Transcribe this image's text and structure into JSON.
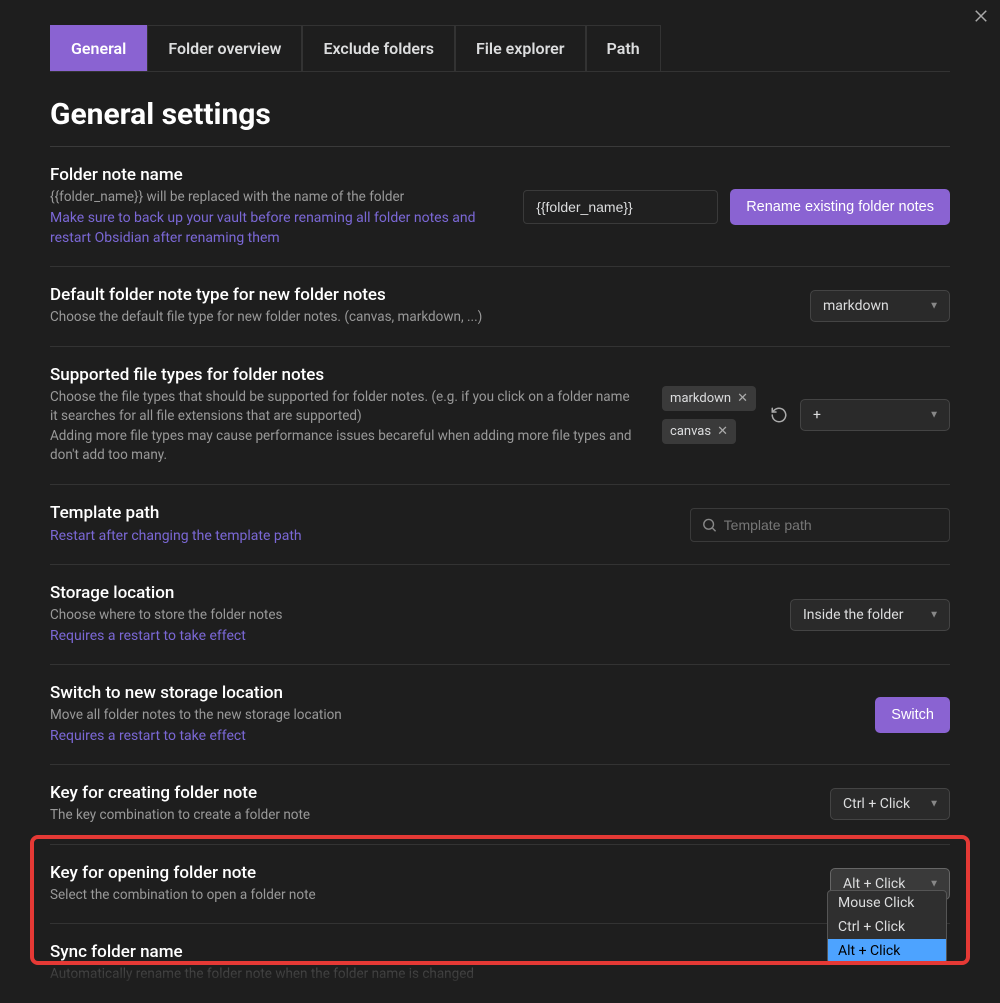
{
  "tabs": [
    "General",
    "Folder overview",
    "Exclude folders",
    "File explorer",
    "Path"
  ],
  "page_title": "General settings",
  "settings": {
    "folder_note_name": {
      "title": "Folder note name",
      "desc": "{{folder_name}} will be replaced with the name of the folder",
      "note": "Make sure to back up your vault before renaming all folder notes and restart Obsidian after renaming them",
      "value": "{{folder_name}}",
      "button": "Rename existing folder notes"
    },
    "default_type": {
      "title": "Default folder note type for new folder notes",
      "desc": "Choose the default file type for new folder notes. (canvas, markdown, ...)",
      "value": "markdown"
    },
    "supported_types": {
      "title": "Supported file types for folder notes",
      "desc1": "Choose the file types that should be supported for folder notes. (e.g. if you click on a folder name it searches for all file extensions that are supported)",
      "desc2": "Adding more file types may cause performance issues becareful when adding more file types and don't add too many.",
      "chips": [
        "markdown",
        "canvas"
      ],
      "add_label": "+"
    },
    "template_path": {
      "title": "Template path",
      "note": "Restart after changing the template path",
      "placeholder": "Template path"
    },
    "storage_location": {
      "title": "Storage location",
      "desc": "Choose where to store the folder notes",
      "note": "Requires a restart to take effect",
      "value": "Inside the folder"
    },
    "switch_storage": {
      "title": "Switch to new storage location",
      "desc": "Move all folder notes to the new storage location",
      "note": "Requires a restart to take effect",
      "button": "Switch"
    },
    "create_key": {
      "title": "Key for creating folder note",
      "desc": "The key combination to create a folder note",
      "value": "Ctrl + Click"
    },
    "open_key": {
      "title": "Key for opening folder note",
      "desc": "Select the combination to open a folder note",
      "value": "Alt + Click",
      "options": [
        "Mouse Click",
        "Ctrl + Click",
        "Alt + Click"
      ]
    },
    "sync_name": {
      "title": "Sync folder name",
      "desc": "Automatically rename the folder note when the folder name is changed"
    }
  }
}
